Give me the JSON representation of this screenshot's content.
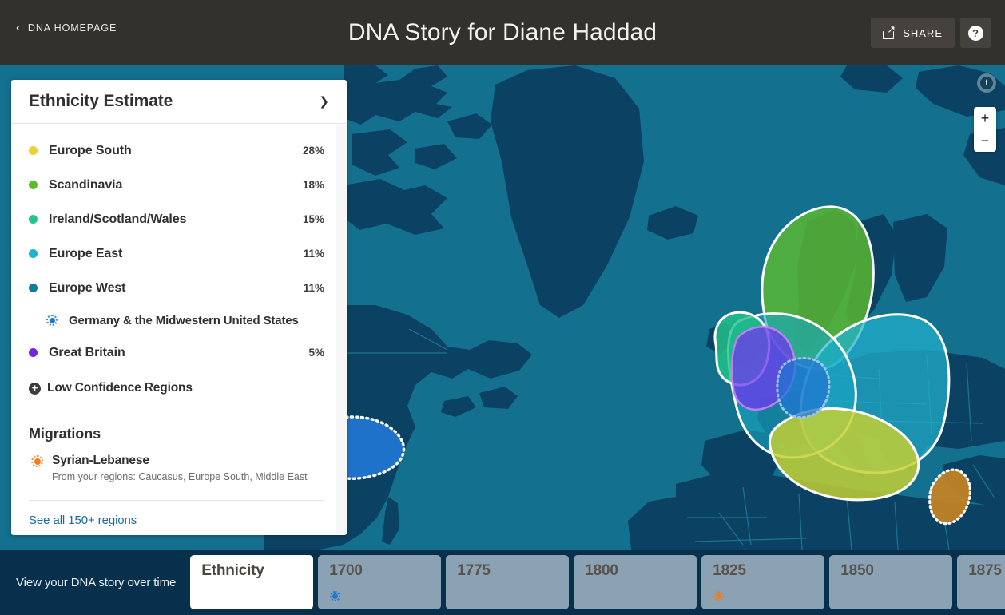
{
  "header": {
    "back_label": "DNA HOMEPAGE",
    "back_icon": "chevron-left-icon",
    "title": "DNA Story for Diane Haddad",
    "share_label": "SHARE",
    "share_icon": "share-icon",
    "help_icon": "question-mark-icon"
  },
  "panel": {
    "title": "Ethnicity Estimate",
    "collapse_icon": "chevron-down-icon",
    "ethnicities": [
      {
        "name": "Europe South",
        "percent": "28%",
        "color": "#e8d332"
      },
      {
        "name": "Scandinavia",
        "percent": "18%",
        "color": "#5cbb30"
      },
      {
        "name": "Ireland/Scotland/Wales",
        "percent": "15%",
        "color": "#23c38a"
      },
      {
        "name": "Europe East",
        "percent": "11%",
        "color": "#21b2cf"
      },
      {
        "name": "Europe West",
        "percent": "11%",
        "color": "#137c9c"
      },
      {
        "name": "Great Britain",
        "percent": "5%",
        "color": "#7528d6"
      }
    ],
    "sub_region": {
      "parent": "Europe West",
      "name": "Germany & the Midwestern United States",
      "marker_color": "#2176d2"
    },
    "low_confidence_label": "Low Confidence Regions",
    "low_confidence_icon": "plus-circle-icon",
    "migrations_title": "Migrations",
    "migrations": [
      {
        "name": "Syrian-Lebanese",
        "detail": "From your regions: Caucasus, Europe South, Middle East",
        "marker_color": "#f07d20"
      }
    ],
    "see_all_label": "See all 150+ regions"
  },
  "map": {
    "info_icon": "info-icon",
    "zoom_in_label": "+",
    "zoom_out_label": "−",
    "ocean_color": "#13708e",
    "land_color": "#0b4263",
    "regions": [
      {
        "name": "Scandinavia",
        "color": "#5cbb30"
      },
      {
        "name": "Europe East",
        "color": "#21b2cf"
      },
      {
        "name": "Europe South",
        "color": "#c6d132"
      },
      {
        "name": "Europe West",
        "color": "#19a8c4"
      },
      {
        "name": "Ireland/Scotland/Wales",
        "color": "#23c38a"
      },
      {
        "name": "Great Britain",
        "color": "#6b3bea"
      },
      {
        "name": "Germany & the Midwestern United States",
        "color": "#2176d2"
      },
      {
        "name": "Syrian-Lebanese migration",
        "color": "#c58321"
      }
    ]
  },
  "timeline": {
    "label": "View your DNA story over time",
    "cards": [
      {
        "year": "Ethnicity",
        "active": true,
        "marker": "none"
      },
      {
        "year": "1700",
        "active": false,
        "marker": "blue"
      },
      {
        "year": "1775",
        "active": false,
        "marker": "none"
      },
      {
        "year": "1800",
        "active": false,
        "marker": "none"
      },
      {
        "year": "1825",
        "active": false,
        "marker": "orange"
      },
      {
        "year": "1850",
        "active": false,
        "marker": "none"
      },
      {
        "year": "1875",
        "active": false,
        "marker": "none"
      }
    ]
  }
}
